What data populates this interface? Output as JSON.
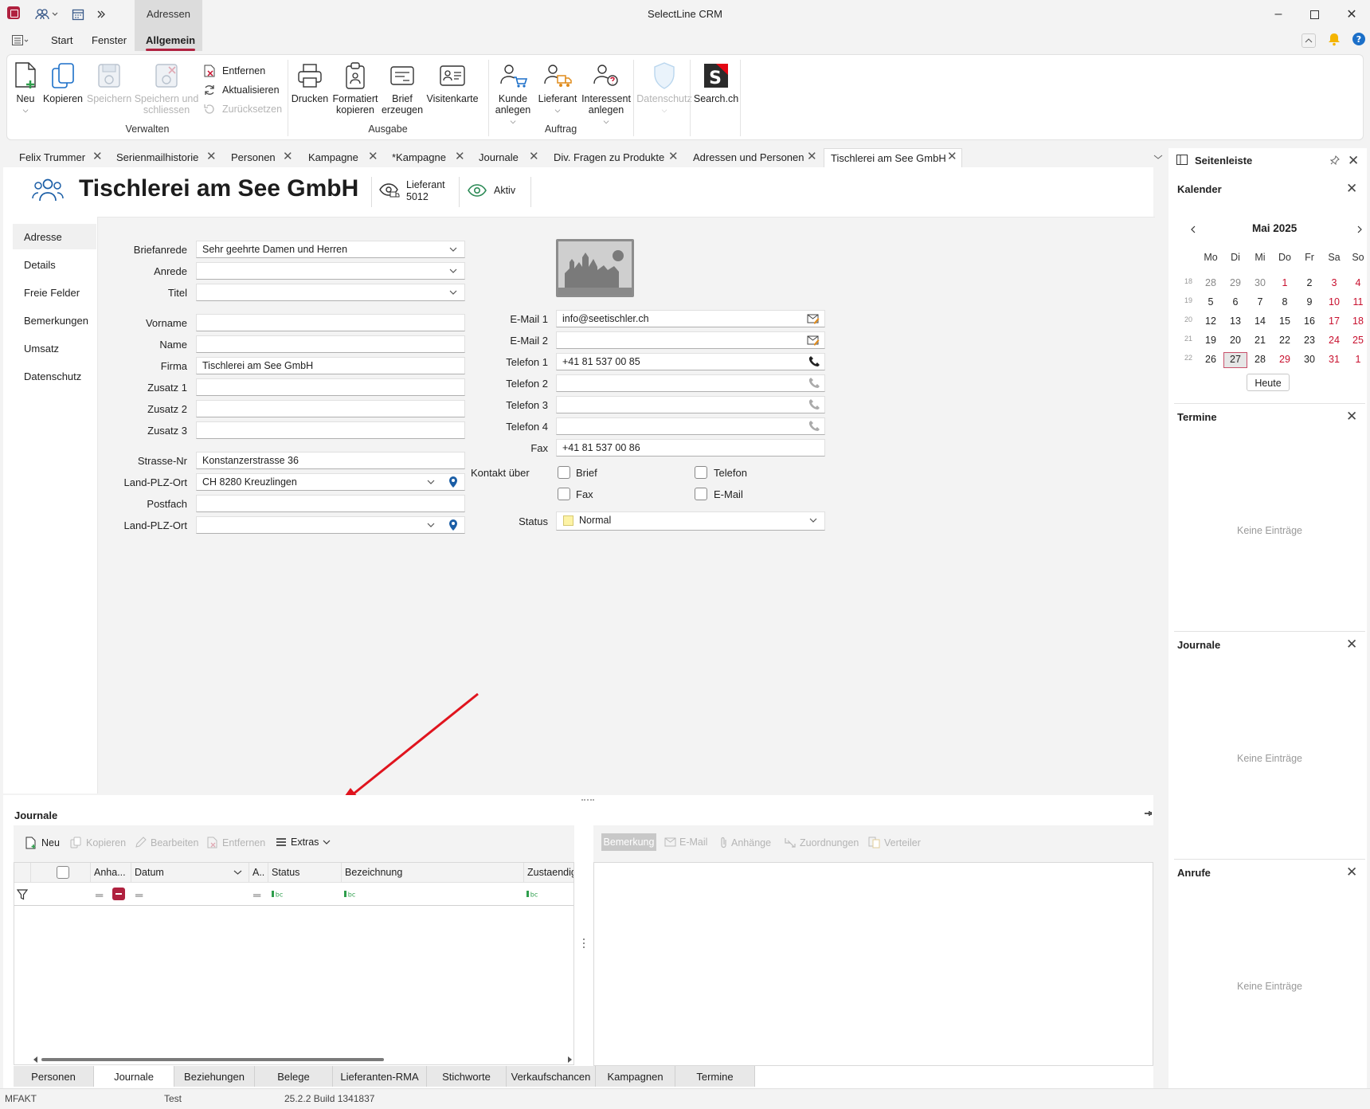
{
  "window": {
    "title": "SelectLine CRM",
    "context_tab": "Adressen"
  },
  "menu": {
    "tabs": [
      "Start",
      "Fenster",
      "Allgemein"
    ],
    "active": "Allgemein"
  },
  "ribbon": {
    "groups": [
      {
        "label": "Verwalten",
        "items": [
          "Neu",
          "Kopieren",
          "Speichern",
          "Speichern und schliessen",
          "Entfernen",
          "Aktualisieren",
          "Zurücksetzen"
        ]
      },
      {
        "label": "Ausgabe",
        "items": [
          "Drucken",
          "Formatiert kopieren",
          "Brief erzeugen",
          "Visitenkarte"
        ]
      },
      {
        "label": "Auftrag",
        "items": [
          "Kunde anlegen",
          "Lieferant",
          "Interessent anlegen"
        ]
      }
    ],
    "neu": "Neu",
    "kopieren": "Kopieren",
    "speichern": "Speichern",
    "speichern_schliessen_1": "Speichern und",
    "speichern_schliessen_2": "schliessen",
    "entfernen": "Entfernen",
    "aktualisieren": "Aktualisieren",
    "zuruecksetzen": "Zurücksetzen",
    "drucken": "Drucken",
    "formatiert_1": "Formatiert",
    "formatiert_2": "kopieren",
    "brief_1": "Brief",
    "brief_2": "erzeugen",
    "visitenkarte": "Visitenkarte",
    "kunde_1": "Kunde",
    "kunde_2": "anlegen",
    "lieferant": "Lieferant",
    "interessent_1": "Interessent",
    "interessent_2": "anlegen",
    "datenschutz": "Datenschutz",
    "search": "Search.ch",
    "grp_verwalten": "Verwalten",
    "grp_ausgabe": "Ausgabe",
    "grp_auftrag": "Auftrag"
  },
  "doc_tabs": [
    "Felix Trummer",
    "Serienmailhistorie",
    "Personen",
    "Kampagne",
    "*Kampagne",
    "Journale",
    "Div. Fragen zu Produkte",
    "Adressen und Personen",
    "Tischlerei am See GmbH"
  ],
  "header": {
    "name": "Tischlerei am See GmbH",
    "role": "Lieferant",
    "number": "5012",
    "status": "Aktiv"
  },
  "left_nav": [
    "Adresse",
    "Details",
    "Freie Felder",
    "Bemerkungen",
    "Umsatz",
    "Datenschutz"
  ],
  "form": {
    "labels": {
      "briefanrede": "Briefanrede",
      "anrede": "Anrede",
      "titel": "Titel",
      "vorname": "Vorname",
      "name": "Name",
      "firma": "Firma",
      "zusatz1": "Zusatz 1",
      "zusatz2": "Zusatz 2",
      "zusatz3": "Zusatz 3",
      "strasse": "Strasse-Nr",
      "land_plz_ort": "Land-PLZ-Ort",
      "postfach": "Postfach",
      "land_plz_ort2": "Land-PLZ-Ort",
      "email1": "E-Mail 1",
      "email2": "E-Mail 2",
      "tel1": "Telefon 1",
      "tel2": "Telefon 2",
      "tel3": "Telefon 3",
      "tel4": "Telefon 4",
      "fax": "Fax",
      "kontakt": "Kontakt über",
      "status": "Status"
    },
    "values": {
      "briefanrede": "Sehr geehrte Damen und Herren",
      "firma": "Tischlerei am See GmbH",
      "strasse": "Konstanzerstrasse 36",
      "land_plz_ort": "CH 8280 Kreuzlingen",
      "email1": "info@seetischler.ch",
      "tel1": "+41 81 537 00 85",
      "fax": "+41 81 537 00 86",
      "status": "Normal"
    },
    "contact": {
      "brief": "Brief",
      "telefon": "Telefon",
      "fax": "Fax",
      "email": "E-Mail"
    },
    "status_color": "#fdf3a6"
  },
  "sidebar": {
    "title": "Seitenleiste",
    "calendar": {
      "title": "Kalender",
      "month": "Mai 2025",
      "weekdays": [
        "Mo",
        "Di",
        "Mi",
        "Do",
        "Fr",
        "Sa",
        "So"
      ],
      "weeks": [
        {
          "w": "18",
          "d": [
            "28",
            "29",
            "30",
            "1",
            "2",
            "3",
            "4"
          ]
        },
        {
          "w": "19",
          "d": [
            "5",
            "6",
            "7",
            "8",
            "9",
            "10",
            "11"
          ]
        },
        {
          "w": "20",
          "d": [
            "12",
            "13",
            "14",
            "15",
            "16",
            "17",
            "18"
          ]
        },
        {
          "w": "21",
          "d": [
            "19",
            "20",
            "21",
            "22",
            "23",
            "24",
            "25"
          ]
        },
        {
          "w": "22",
          "d": [
            "26",
            "27",
            "28",
            "29",
            "30",
            "31",
            "1"
          ]
        }
      ],
      "today": "27",
      "today_button": "Heute"
    },
    "termine": {
      "title": "Termine",
      "empty": "Keine Einträge"
    },
    "journale": {
      "title": "Journale",
      "empty": "Keine Einträge"
    },
    "anrufe": {
      "title": "Anrufe",
      "empty": "Keine Einträge"
    }
  },
  "journale_panel": {
    "title": "Journale",
    "toolbar": [
      "Neu",
      "Kopieren",
      "Bearbeiten",
      "Entfernen",
      "Extras"
    ],
    "columns": [
      "Anha...",
      "Datum",
      "A..",
      "Status",
      "Bezeichnung",
      "Zustaendig"
    ],
    "detail_toolbar": [
      "Bemerkung",
      "E-Mail",
      "Anhänge",
      "Zuordnungen",
      "Verteiler"
    ]
  },
  "bottom_tabs": [
    "Personen",
    "Journale",
    "Beziehungen",
    "Belege",
    "Lieferanten-RMA",
    "Stichworte",
    "Verkaufschancen",
    "Kampagnen",
    "Termine"
  ],
  "bottom_active": "Journale",
  "statusbar": {
    "left": "MFAKT",
    "middle": "Test",
    "version": "25.2.2 Build 1341837"
  },
  "colors": {
    "accent": "#b0213f",
    "arrow": "#e0141e",
    "weekend": "#c8102e"
  }
}
